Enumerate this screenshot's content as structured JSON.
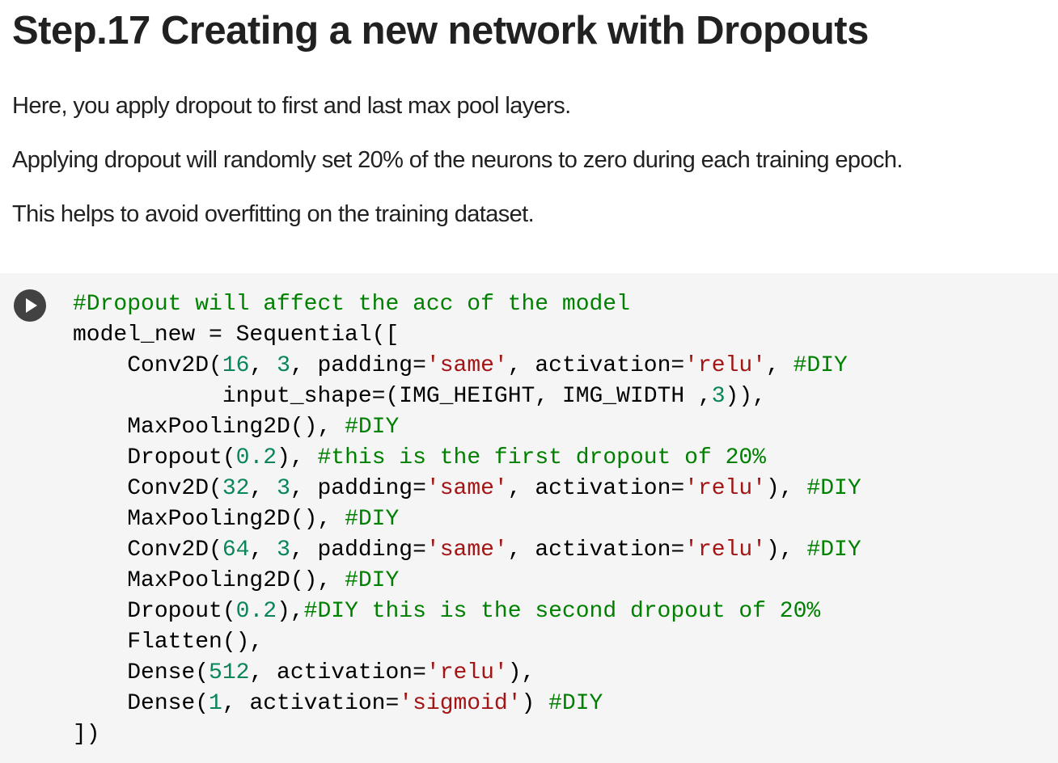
{
  "markdown": {
    "heading": "Step.17 Creating a new network with Dropouts",
    "paragraphs": [
      "Here, you apply dropout to first and last max pool layers.",
      "Applying dropout will randomly set 20% of the neurons to zero during each training epoch.",
      "This helps to avoid overfitting on the training dataset."
    ]
  },
  "code_cell": {
    "run_button_icon": "play-icon",
    "colors": {
      "comment": "#008000",
      "string": "#a31515",
      "number": "#098658",
      "plain": "#000000",
      "cell_background": "#f5f5f5",
      "run_button": "#424242"
    },
    "lines": [
      [
        {
          "t": "comment",
          "v": "#Dropout will affect the acc of the model"
        }
      ],
      [
        {
          "t": "plain",
          "v": "model_new = Sequential(["
        }
      ],
      [
        {
          "t": "plain",
          "v": "    Conv2D("
        },
        {
          "t": "number",
          "v": "16"
        },
        {
          "t": "plain",
          "v": ", "
        },
        {
          "t": "number",
          "v": "3"
        },
        {
          "t": "plain",
          "v": ", padding="
        },
        {
          "t": "string",
          "v": "'same'"
        },
        {
          "t": "plain",
          "v": ", activation="
        },
        {
          "t": "string",
          "v": "'relu'"
        },
        {
          "t": "plain",
          "v": ", "
        },
        {
          "t": "comment",
          "v": "#DIY"
        }
      ],
      [
        {
          "t": "plain",
          "v": "           input_shape=(IMG_HEIGHT, IMG_WIDTH ,"
        },
        {
          "t": "number",
          "v": "3"
        },
        {
          "t": "plain",
          "v": ")),"
        }
      ],
      [
        {
          "t": "plain",
          "v": "    MaxPooling2D(), "
        },
        {
          "t": "comment",
          "v": "#DIY"
        }
      ],
      [
        {
          "t": "plain",
          "v": "    Dropout("
        },
        {
          "t": "number",
          "v": "0.2"
        },
        {
          "t": "plain",
          "v": "), "
        },
        {
          "t": "comment",
          "v": "#this is the first dropout of 20%"
        }
      ],
      [
        {
          "t": "plain",
          "v": "    Conv2D("
        },
        {
          "t": "number",
          "v": "32"
        },
        {
          "t": "plain",
          "v": ", "
        },
        {
          "t": "number",
          "v": "3"
        },
        {
          "t": "plain",
          "v": ", padding="
        },
        {
          "t": "string",
          "v": "'same'"
        },
        {
          "t": "plain",
          "v": ", activation="
        },
        {
          "t": "string",
          "v": "'relu'"
        },
        {
          "t": "plain",
          "v": "), "
        },
        {
          "t": "comment",
          "v": "#DIY"
        }
      ],
      [
        {
          "t": "plain",
          "v": "    MaxPooling2D(), "
        },
        {
          "t": "comment",
          "v": "#DIY"
        }
      ],
      [
        {
          "t": "plain",
          "v": "    Conv2D("
        },
        {
          "t": "number",
          "v": "64"
        },
        {
          "t": "plain",
          "v": ", "
        },
        {
          "t": "number",
          "v": "3"
        },
        {
          "t": "plain",
          "v": ", padding="
        },
        {
          "t": "string",
          "v": "'same'"
        },
        {
          "t": "plain",
          "v": ", activation="
        },
        {
          "t": "string",
          "v": "'relu'"
        },
        {
          "t": "plain",
          "v": "), "
        },
        {
          "t": "comment",
          "v": "#DIY"
        }
      ],
      [
        {
          "t": "plain",
          "v": "    MaxPooling2D(), "
        },
        {
          "t": "comment",
          "v": "#DIY"
        }
      ],
      [
        {
          "t": "plain",
          "v": "    Dropout("
        },
        {
          "t": "number",
          "v": "0.2"
        },
        {
          "t": "plain",
          "v": "),"
        },
        {
          "t": "comment",
          "v": "#DIY this is the second dropout of 20%"
        }
      ],
      [
        {
          "t": "plain",
          "v": "    Flatten(),"
        }
      ],
      [
        {
          "t": "plain",
          "v": "    Dense("
        },
        {
          "t": "number",
          "v": "512"
        },
        {
          "t": "plain",
          "v": ", activation="
        },
        {
          "t": "string",
          "v": "'relu'"
        },
        {
          "t": "plain",
          "v": "),"
        }
      ],
      [
        {
          "t": "plain",
          "v": "    Dense("
        },
        {
          "t": "number",
          "v": "1"
        },
        {
          "t": "plain",
          "v": ", activation="
        },
        {
          "t": "string",
          "v": "'sigmoid'"
        },
        {
          "t": "plain",
          "v": ") "
        },
        {
          "t": "comment",
          "v": "#DIY"
        }
      ],
      [
        {
          "t": "plain",
          "v": "])"
        }
      ]
    ]
  }
}
